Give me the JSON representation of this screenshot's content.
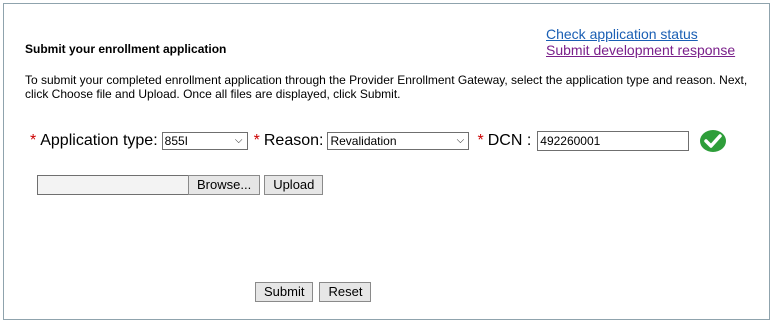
{
  "header": {
    "title": "Submit your enrollment application",
    "links": {
      "check_status": "Check application status",
      "submit_dev_response": "Submit development response"
    }
  },
  "instructions": "To submit your completed enrollment application through the Provider Enrollment Gateway, select the application type and reason. Next, click Choose file and Upload. Once all files are displayed, click Submit.",
  "form": {
    "required_mark": "*",
    "application_type": {
      "label": "Application type:",
      "value": "855I"
    },
    "reason": {
      "label": "Reason:",
      "value": "Revalidation"
    },
    "dcn": {
      "label": "DCN :",
      "value": "492260001"
    },
    "validation_icon": "check-circle-icon",
    "validation_color": "#2e9e3a"
  },
  "upload": {
    "browse_label": "Browse...",
    "upload_label": "Upload"
  },
  "actions": {
    "submit_label": "Submit",
    "reset_label": "Reset"
  }
}
